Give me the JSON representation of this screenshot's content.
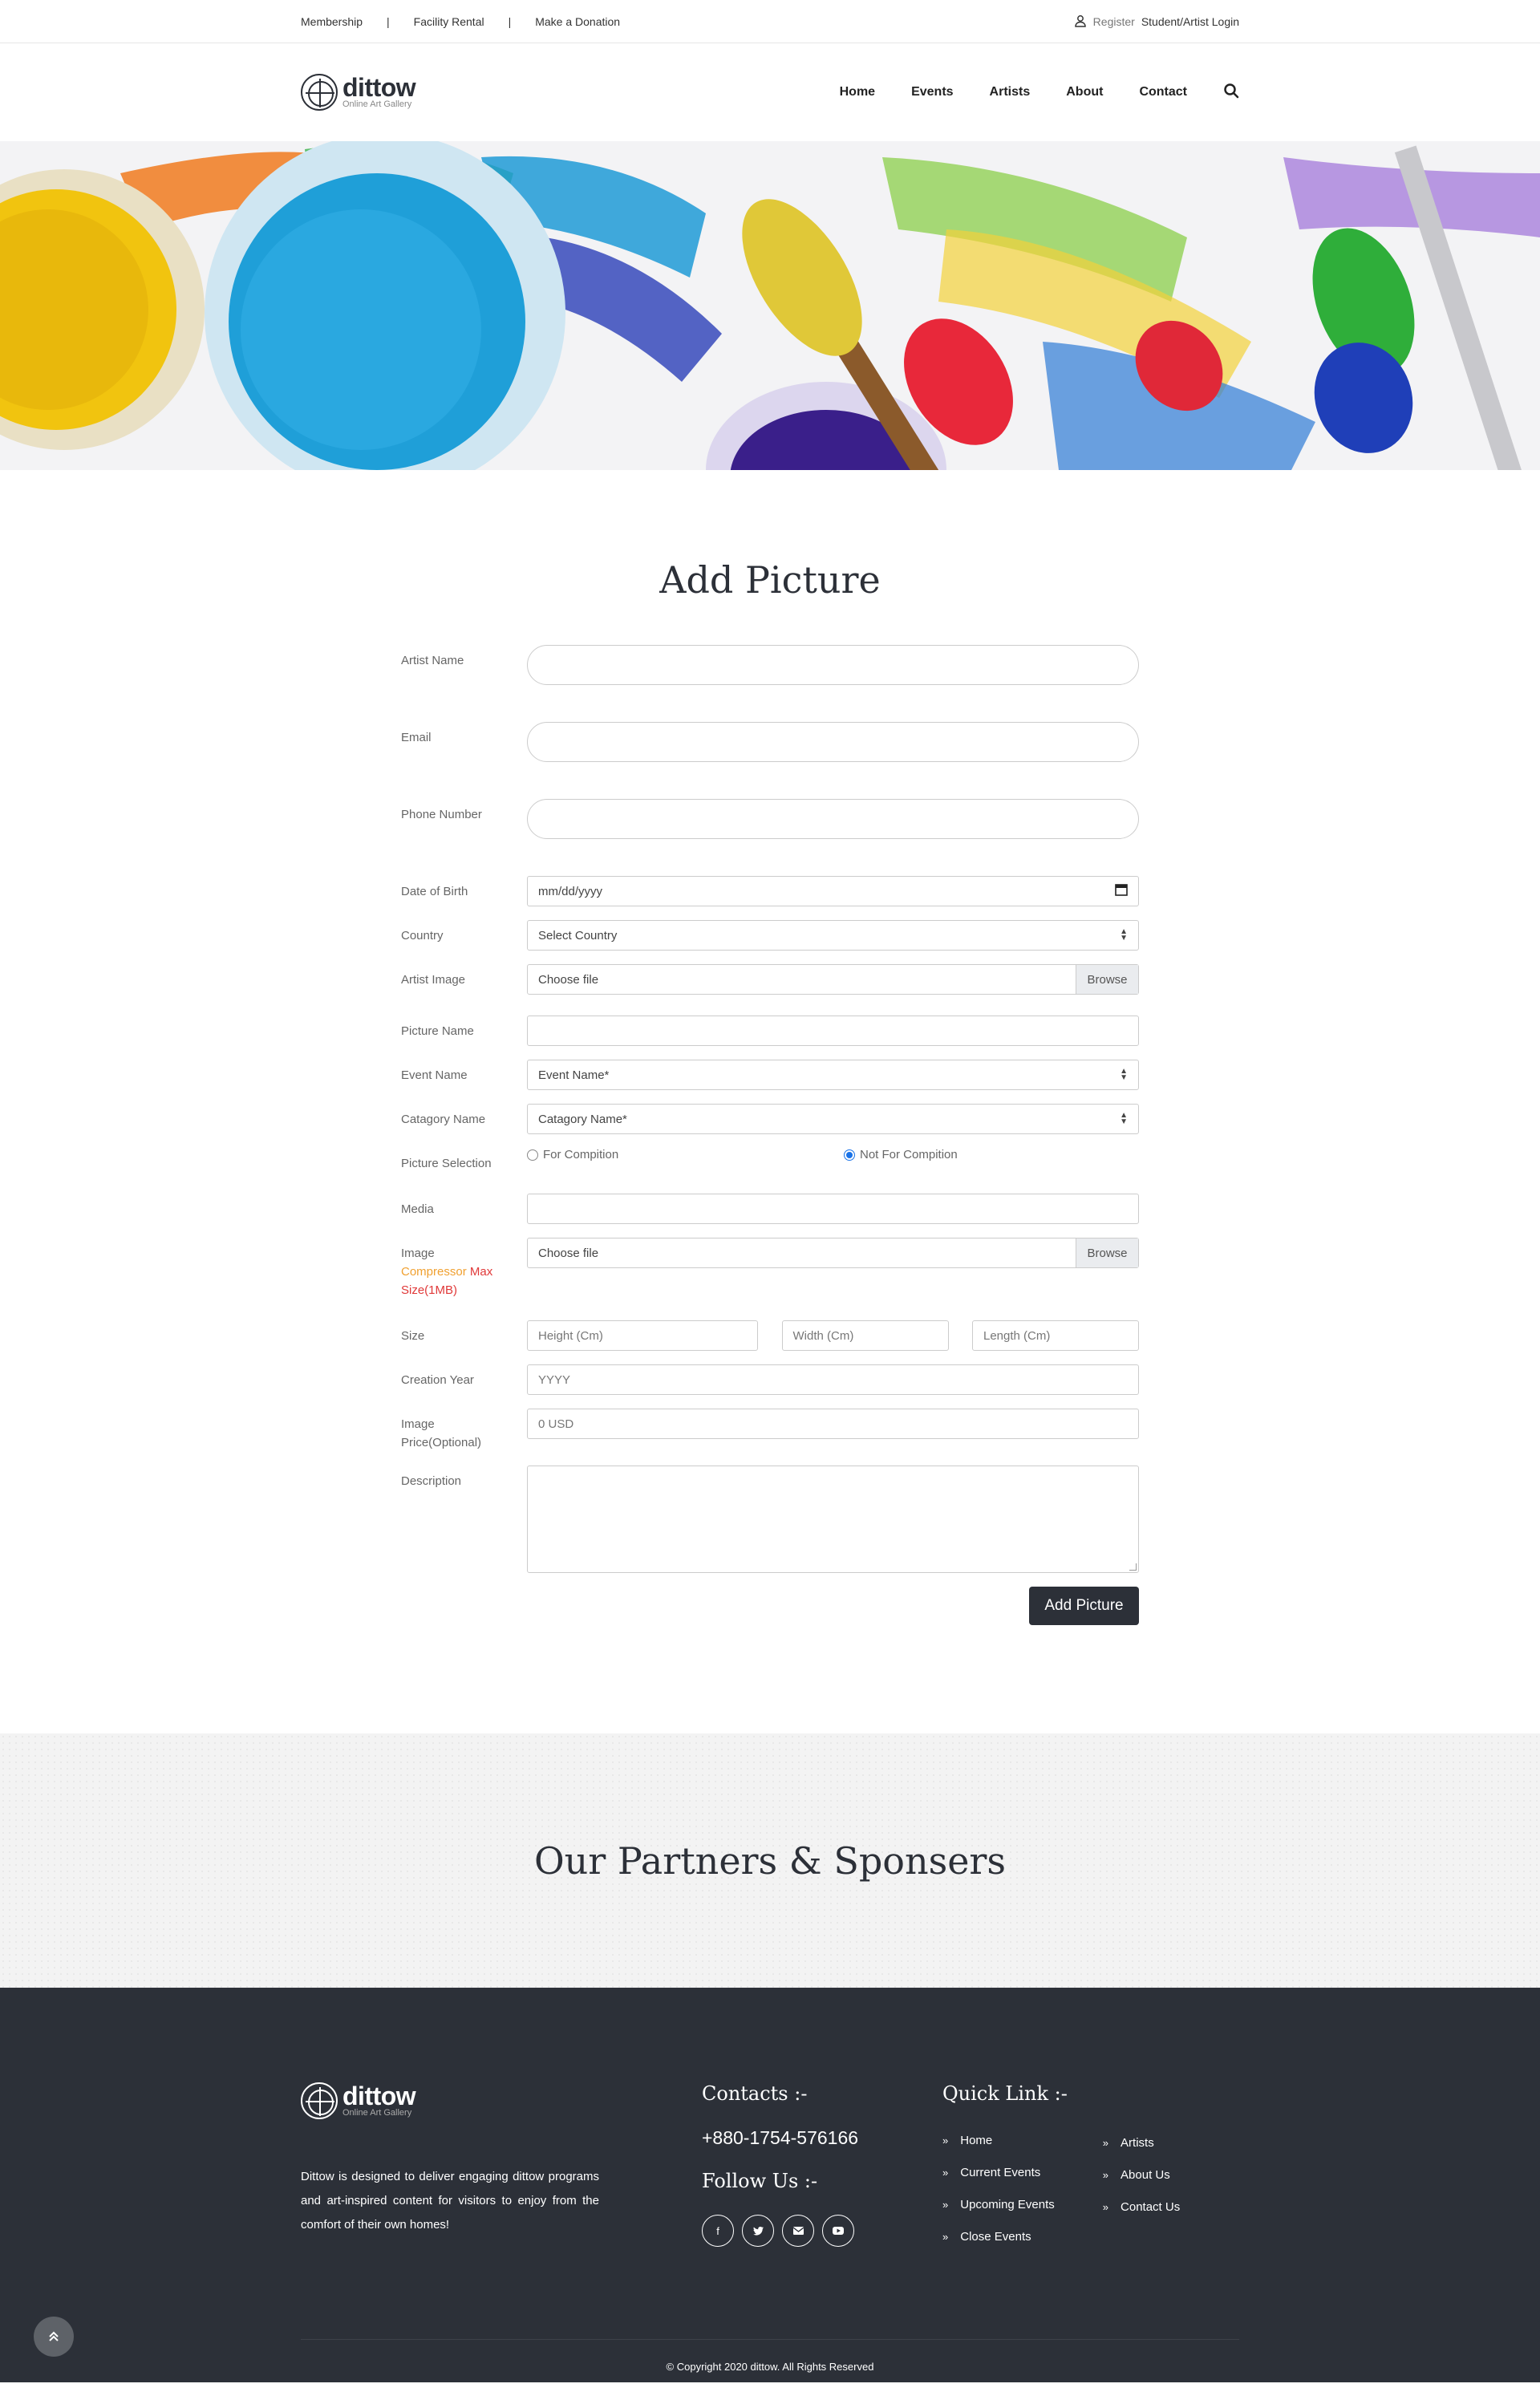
{
  "topbar": {
    "links": [
      "Membership",
      "Facility Rental",
      "Make a Donation"
    ],
    "separator": "|",
    "register": "Register",
    "login": "Student/Artist Login"
  },
  "brand": {
    "name": "dittow",
    "tagline": "Online Art Gallery"
  },
  "nav": {
    "items": [
      "Home",
      "Events",
      "Artists",
      "About",
      "Contact"
    ]
  },
  "form": {
    "title": "Add Picture",
    "artist_name_label": "Artist Name",
    "email_label": "Email",
    "phone_label": "Phone Number",
    "dob_label": "Date of Birth",
    "dob_placeholder": "mm/dd/yyyy",
    "country_label": "Country",
    "country_value": "Select Country",
    "artist_image_label": "Artist Image",
    "file_choose": "Choose file",
    "file_browse": "Browse",
    "picture_name_label": "Picture Name",
    "event_name_label": "Event Name",
    "event_name_value": "Event Name*",
    "category_label": "Catagory Name",
    "category_value": "Catagory Name*",
    "selection_label": "Picture Selection",
    "selection_options": [
      {
        "label": "For Compition",
        "checked": false
      },
      {
        "label": "Not For Compition",
        "checked": true
      }
    ],
    "media_label": "Media",
    "image_label_1": "Image",
    "image_label_2": "Compressor",
    "image_label_3": "Max",
    "image_label_4": "Size(1MB)",
    "size_label": "Size",
    "height_ph": "Height (Cm)",
    "width_ph": "Width (Cm)",
    "length_ph": "Length (Cm)",
    "year_label": "Creation Year",
    "year_ph": "YYYY",
    "price_label_1": "Image",
    "price_label_2": "Price(Optional)",
    "price_ph": "0 USD",
    "description_label": "Description",
    "submit_label": "Add Picture"
  },
  "partners": {
    "title": "Our Partners & Sponsers"
  },
  "footer": {
    "about": "Dittow is designed to deliver engaging dittow programs and art-inspired content for visitors to enjoy from the comfort of their own homes!",
    "contacts_title": "Contacts :-",
    "phone": "+880-1754-576166",
    "follow_title": "Follow Us :-",
    "quick_title": "Quick Link :-",
    "quick_col1": [
      "Home",
      "Current Events",
      "Upcoming Events",
      "Close Events"
    ],
    "quick_col2": [
      "Artists",
      "About Us",
      "Contact Us"
    ],
    "copyright": "© Copyright 2020 dittow. All Rights Reserved"
  },
  "colors": {
    "dark": "#2c3038",
    "accent_orange": "#f0a030",
    "accent_red": "#e03838",
    "radio_blue": "#1a73e8"
  }
}
